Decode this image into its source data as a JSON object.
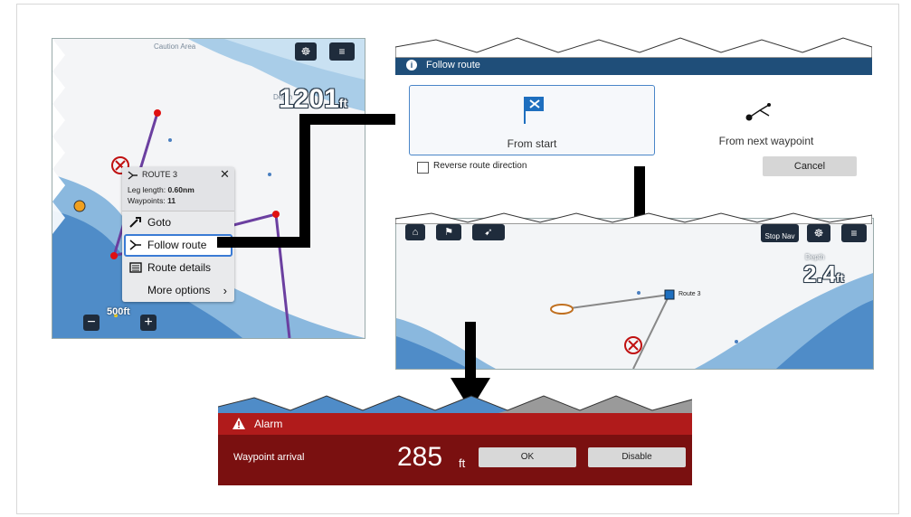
{
  "panel1": {
    "map_labels": {
      "caution": "Caution Area",
      "depth": "Depth"
    },
    "depth": {
      "value": "1201",
      "unit": "ft"
    },
    "scale": {
      "value": "500ft",
      "minus": "−",
      "plus": "+"
    },
    "context_menu": {
      "route_name": "ROUTE 3",
      "leg_length_label": "Leg length:",
      "leg_length_value": "0.60nm",
      "waypoints_label": "Waypoints:",
      "waypoints_value": "11",
      "close": "✕",
      "items": [
        {
          "label": "Goto",
          "icon": "goto-icon"
        },
        {
          "label": "Follow route",
          "icon": "route-icon"
        },
        {
          "label": "Route details",
          "icon": "list-icon"
        },
        {
          "label": "More options",
          "icon": "chevron-right-icon"
        }
      ]
    }
  },
  "panel2": {
    "title": "Follow route",
    "option_start": "From start",
    "option_next": "From next waypoint",
    "reverse_label": "Reverse route direction",
    "cancel": "Cancel"
  },
  "panel3": {
    "stop_nav": "Stop Nav",
    "depth_label": "Depth",
    "depth": {
      "value": "2.4",
      "unit": "ft"
    },
    "route_label": "Route 3"
  },
  "panel4": {
    "title": "Alarm",
    "message": "Waypoint arrival",
    "distance": {
      "value": "285",
      "unit": "ft"
    },
    "ok": "OK",
    "disable": "Disable"
  },
  "colors": {
    "navy": "#1f4e79",
    "alarm_red": "#b01b1b",
    "alarm_dark": "#7a1010",
    "route_purple": "#6b3fa0",
    "sea_blue": "#8ab8de"
  }
}
